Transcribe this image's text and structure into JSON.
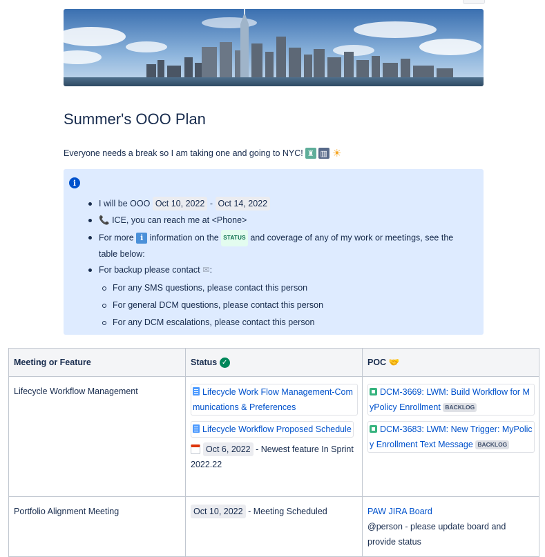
{
  "page": {
    "title": "Summer's OOO Plan",
    "intro": "Everyone needs a break so I am taking one and going to NYC!",
    "intro_emojis": [
      "statue-of-liberty-emoji",
      "cityscape-emoji",
      "sun-emoji"
    ]
  },
  "panel": {
    "bullet1_prefix": "I will be OOO",
    "date_start": "Oct 10, 2022",
    "date_sep": "-",
    "date_end": "Oct 14, 2022",
    "bullet2": "ICE, you can reach me at <Phone>",
    "bullet3_a": "For more",
    "bullet3_b": "information on the",
    "status_lozenge": "STATUS",
    "bullet3_c": "and coverage of any of my work or meetings, see the",
    "bullet3_d": "table below:",
    "bullet4": "For backup please contact",
    "bullet4_suffix": ":",
    "sub1": "For any SMS questions, please contact this person",
    "sub2": "For general DCM questions, please contact this person",
    "sub3": "For any DCM escalations, please contact this person"
  },
  "table": {
    "headers": [
      "Meeting or Feature",
      "Status",
      "POC"
    ],
    "row1": {
      "feature": "Lifecycle Workflow Management",
      "status_link1_a": "Lifecycle Work Flow Management-Com",
      "status_link1_b": "munications & Preferences",
      "status_link2": "Lifecycle Workflow Proposed Schedule",
      "status_date": "Oct 6, 2022",
      "status_note_a": "- Newest feature In Sprint",
      "status_note_b": "2022.22",
      "poc_issue1_a": "DCM-3669: LWM: Build Workflow for M",
      "poc_issue1_b": "yPolicy Enrollment",
      "poc_issue2_a": "DCM-3683: LWM: New Trigger: MyPolic",
      "poc_issue2_b": "y Enrollment Text Message",
      "backlog": "BACKLOG"
    },
    "row2": {
      "feature": "Portfolio Alignment Meeting",
      "status_date": "Oct 10, 2022",
      "status_note": "- Meeting Scheduled",
      "poc_link": "PAW JIRA Board",
      "poc_note_a": "@person - please update board and",
      "poc_note_b": "provide status"
    }
  },
  "colors": {
    "panel_bg": "#deebff",
    "link": "#0052cc",
    "text": "#172b4d",
    "status_green": "#00875a"
  }
}
